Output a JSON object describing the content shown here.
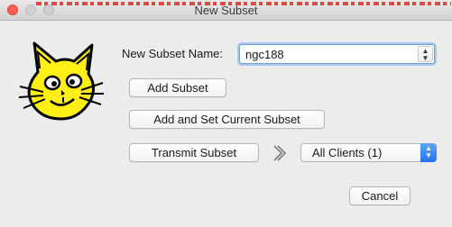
{
  "window": {
    "title": "New Subset"
  },
  "form": {
    "name_label": "New Subset Name:",
    "name_value": "ngc188"
  },
  "buttons": {
    "add_subset": "Add Subset",
    "add_and_set_current": "Add and Set Current Subset",
    "transmit_subset": "Transmit Subset",
    "cancel": "Cancel"
  },
  "clients": {
    "selected": "All Clients (1)"
  },
  "icons": {
    "logo": "cat-face-icon",
    "forward": "chevron-right-icon",
    "combo_arrows": "updown-arrows-icon"
  },
  "colors": {
    "logo_fill": "#ffef14",
    "select_accent": "#2f7cf6",
    "close_button": "#fc5f57"
  }
}
